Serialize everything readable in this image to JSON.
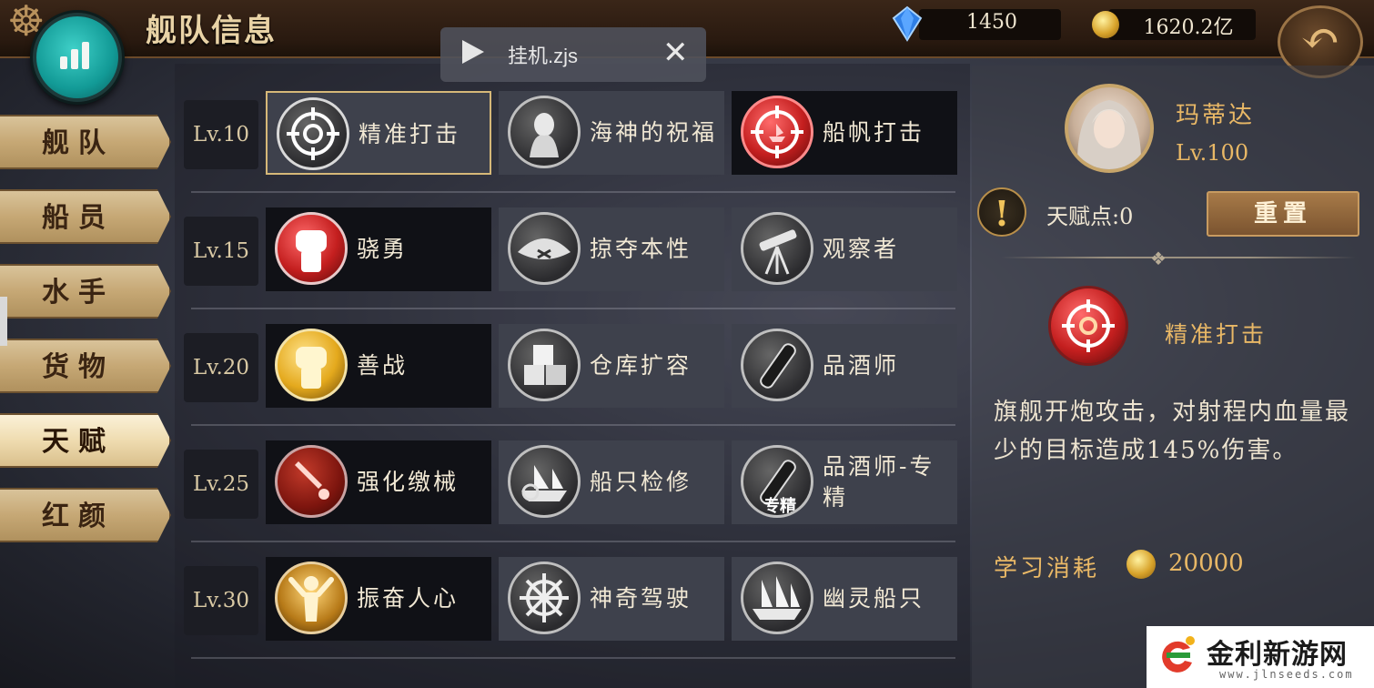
{
  "header": {
    "title": "舰队信息",
    "gems": "1450",
    "gold": "1620.2亿"
  },
  "macro_popup": {
    "file": "挂机.zjs"
  },
  "side_tabs": [
    {
      "label": "舰队",
      "active": false
    },
    {
      "label": "船员",
      "active": false
    },
    {
      "label": "水手",
      "active": false
    },
    {
      "label": "货物",
      "active": false
    },
    {
      "label": "天赋",
      "active": true
    },
    {
      "label": "红颜",
      "active": false
    }
  ],
  "talent_rows": [
    {
      "level": "Lv.10",
      "talents": [
        {
          "name": "精准打击",
          "icon": "crosshair-icon",
          "style": "gray",
          "state": "selected"
        },
        {
          "name": "海神的祝福",
          "icon": "sea-god-icon",
          "style": "gray",
          "state": "normal"
        },
        {
          "name": "船帆打击",
          "icon": "sail-target-icon",
          "style": "red",
          "state": "learned"
        }
      ]
    },
    {
      "level": "Lv.15",
      "talents": [
        {
          "name": "骁勇",
          "icon": "fist-icon",
          "style": "red",
          "state": "learned"
        },
        {
          "name": "掠夺本性",
          "icon": "pirate-hat-icon",
          "style": "gray",
          "state": "normal"
        },
        {
          "name": "观察者",
          "icon": "telescope-icon",
          "style": "gray",
          "state": "normal"
        }
      ]
    },
    {
      "level": "Lv.20",
      "talents": [
        {
          "name": "善战",
          "icon": "fist-icon",
          "style": "gold",
          "state": "learned"
        },
        {
          "name": "仓库扩容",
          "icon": "crates-icon",
          "style": "gray",
          "state": "normal"
        },
        {
          "name": "品酒师",
          "icon": "bottle-icon",
          "style": "gray",
          "state": "normal"
        }
      ]
    },
    {
      "level": "Lv.25",
      "talents": [
        {
          "name": "强化缴械",
          "icon": "dagger-icon",
          "style": "dred",
          "state": "learned"
        },
        {
          "name": "船只检修",
          "icon": "ship-repair-icon",
          "style": "gray",
          "state": "normal"
        },
        {
          "name": "品酒师-专精",
          "icon": "bottle-icon",
          "style": "gray",
          "state": "normal",
          "tag": "专精"
        }
      ]
    },
    {
      "level": "Lv.30",
      "talents": [
        {
          "name": "振奋人心",
          "icon": "cheering-man-icon",
          "style": "amber",
          "state": "learned"
        },
        {
          "name": "神奇驾驶",
          "icon": "ship-wheel-icon",
          "style": "gray",
          "state": "normal"
        },
        {
          "name": "幽灵船只",
          "icon": "ghost-ship-icon",
          "style": "gray",
          "state": "normal"
        }
      ]
    }
  ],
  "hero": {
    "name": "玛蒂达",
    "level": "Lv.100",
    "talent_points": "天赋点:0",
    "reset_label": "重置"
  },
  "selected_talent": {
    "name": "精准打击",
    "description": "旗舰开炮攻击，对射程内血量最少的目标造成145%伤害。",
    "cost_label": "学习消耗",
    "cost": "20000"
  },
  "watermark": {
    "title": "金利新游网",
    "url": "www.jlnseeds.com"
  },
  "colors": {
    "accent_gold": "#e9b866",
    "tab_active": "#efdcb0",
    "selected_border": "#d6b878"
  }
}
